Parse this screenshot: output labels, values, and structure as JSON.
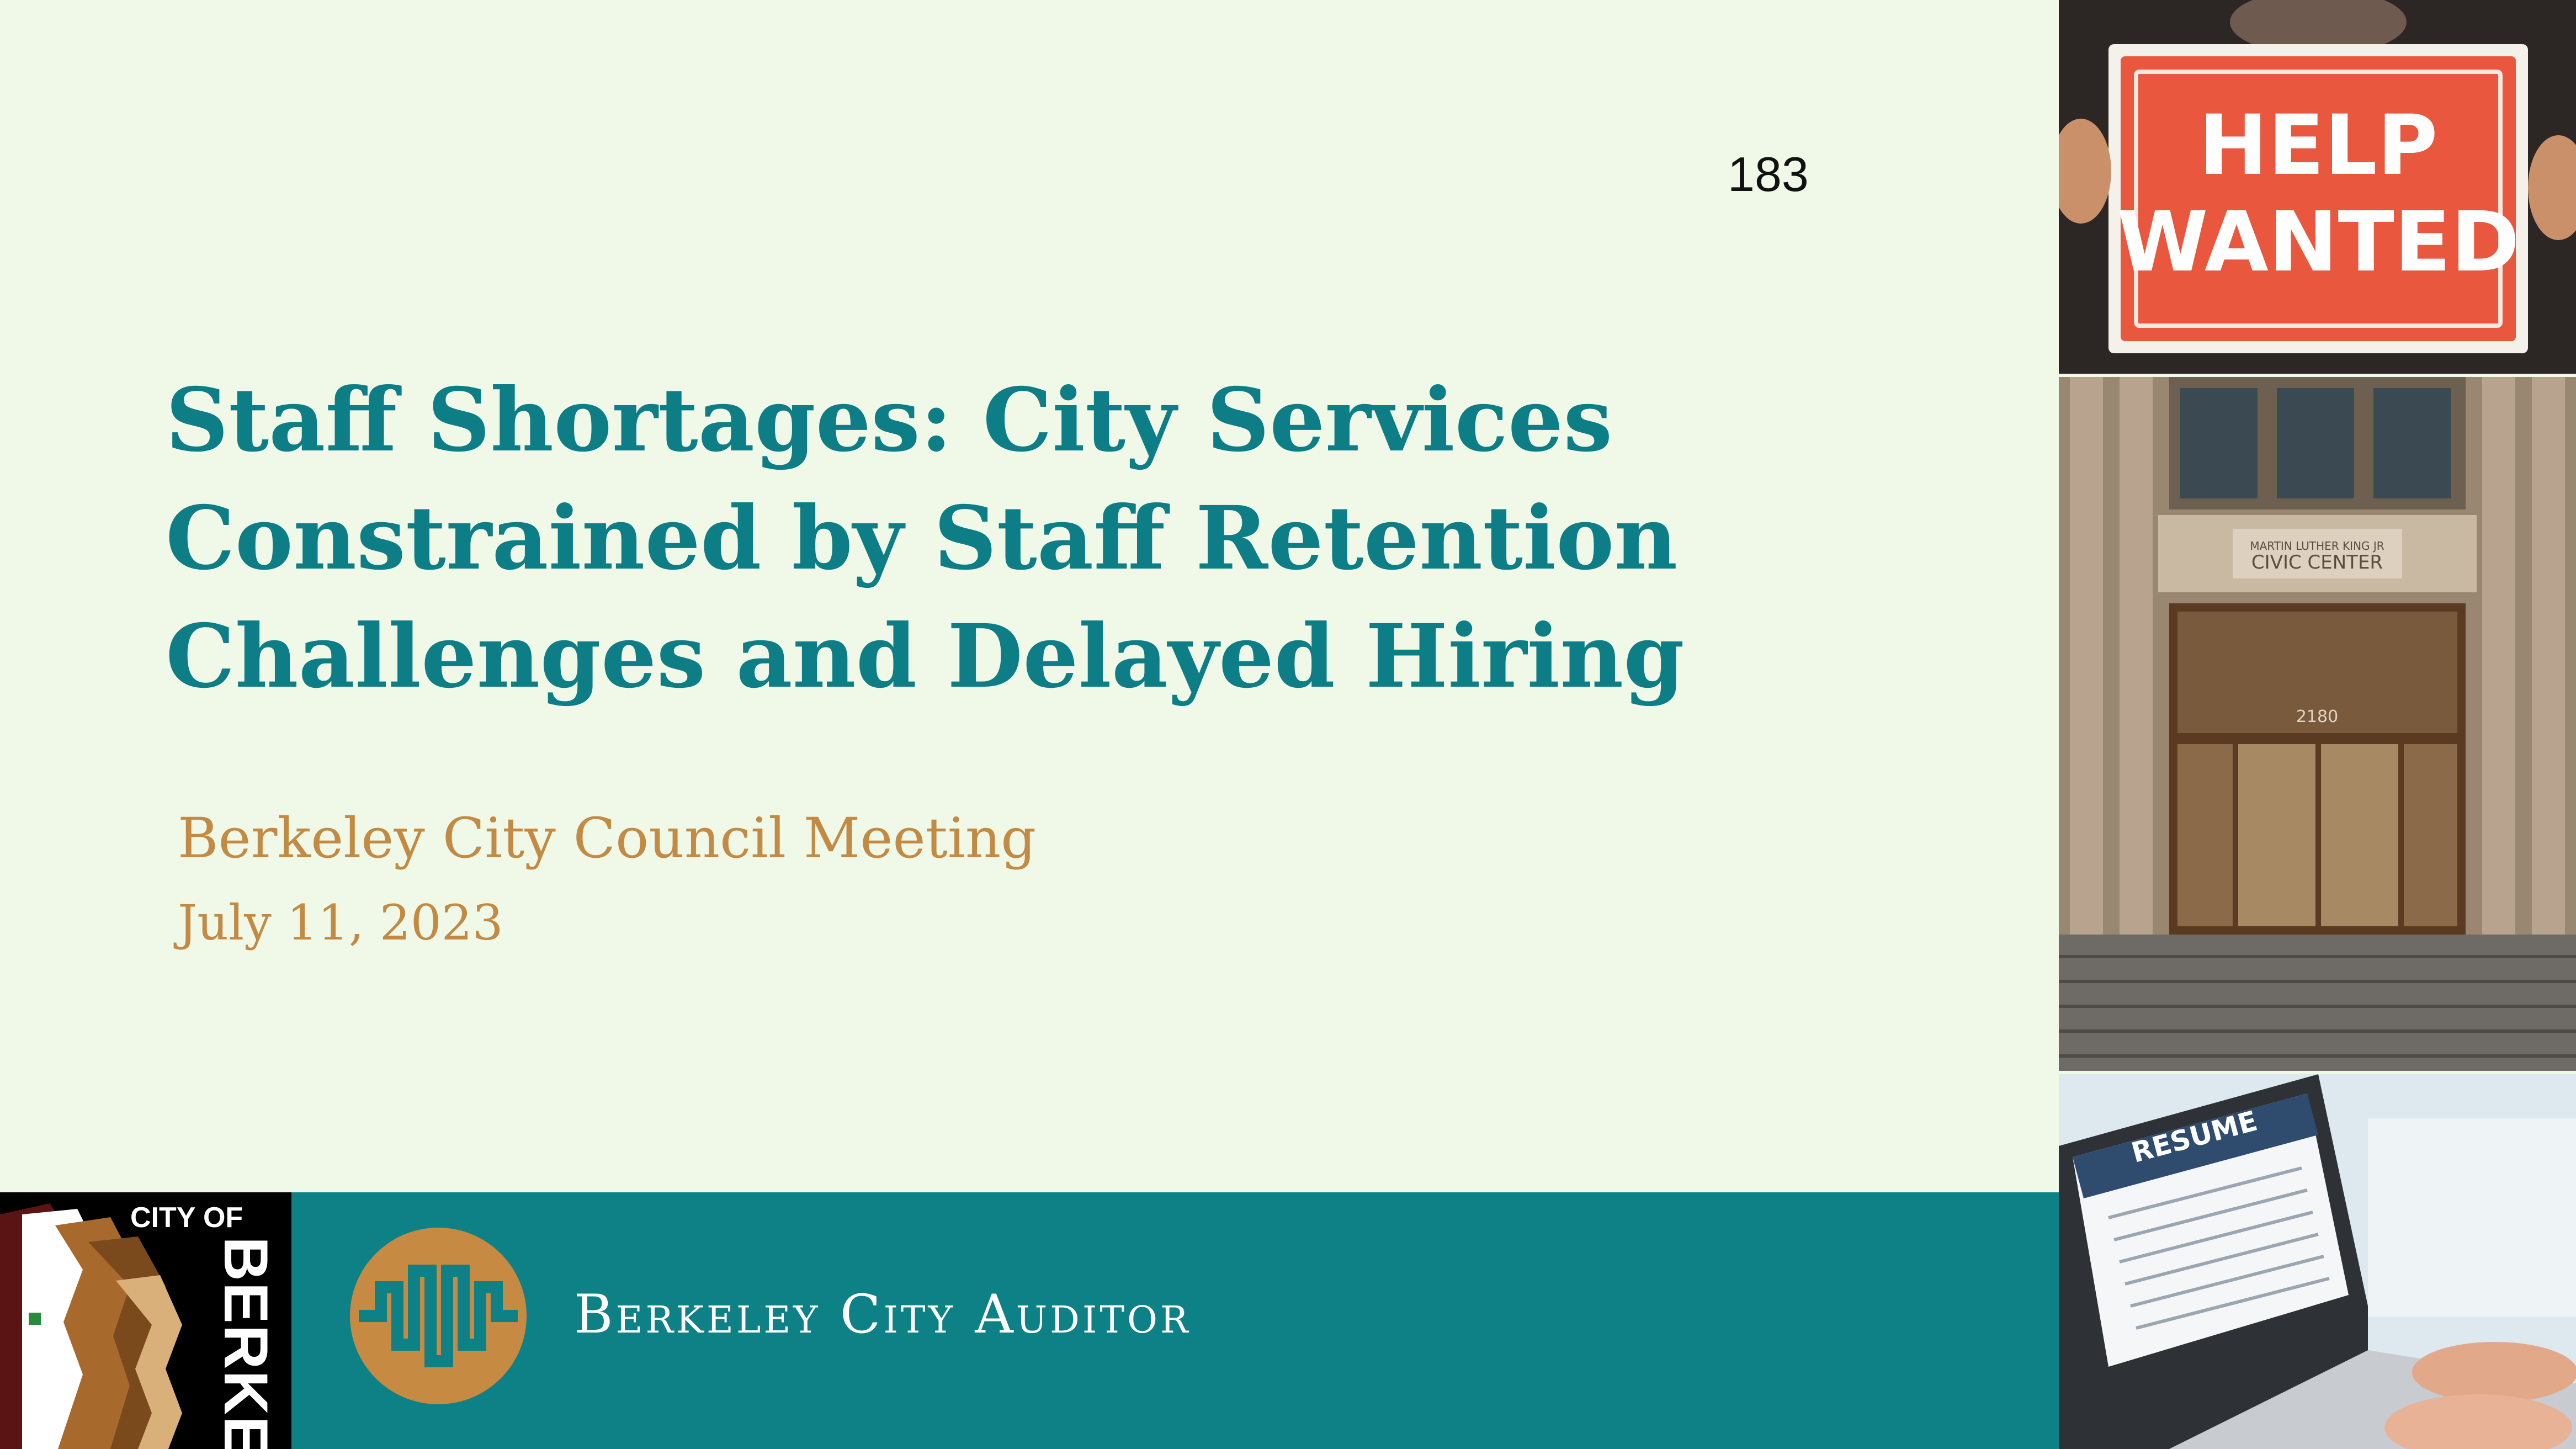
{
  "slide": {
    "page_number": "183",
    "title_lines": [
      "Staff Shortages: City Services",
      "Constrained by Staff Retention",
      "Challenges and Delayed Hiring"
    ],
    "subtitle": "Berkeley City Council Meeting",
    "date": "July 11, 2023"
  },
  "footer": {
    "city_logo": {
      "line1": "CITY OF",
      "line2": "BERKELEY"
    },
    "auditor_name": "Berkeley City Auditor"
  },
  "photos": {
    "help_wanted": {
      "sign_line1": "HELP",
      "sign_line2": "WANTED"
    },
    "civic_center": {
      "plaque_line1": "MARTIN LUTHER KING JR",
      "plaque_line2": "CIVIC CENTER",
      "address": "2180"
    },
    "resume": {
      "heading": "RESUME"
    }
  },
  "colors": {
    "background": "#f0f8e8",
    "title": "#0e7e86",
    "subtitle": "#c38a44",
    "footer": "#0e8186",
    "auditor_mark": "#c68a43"
  }
}
